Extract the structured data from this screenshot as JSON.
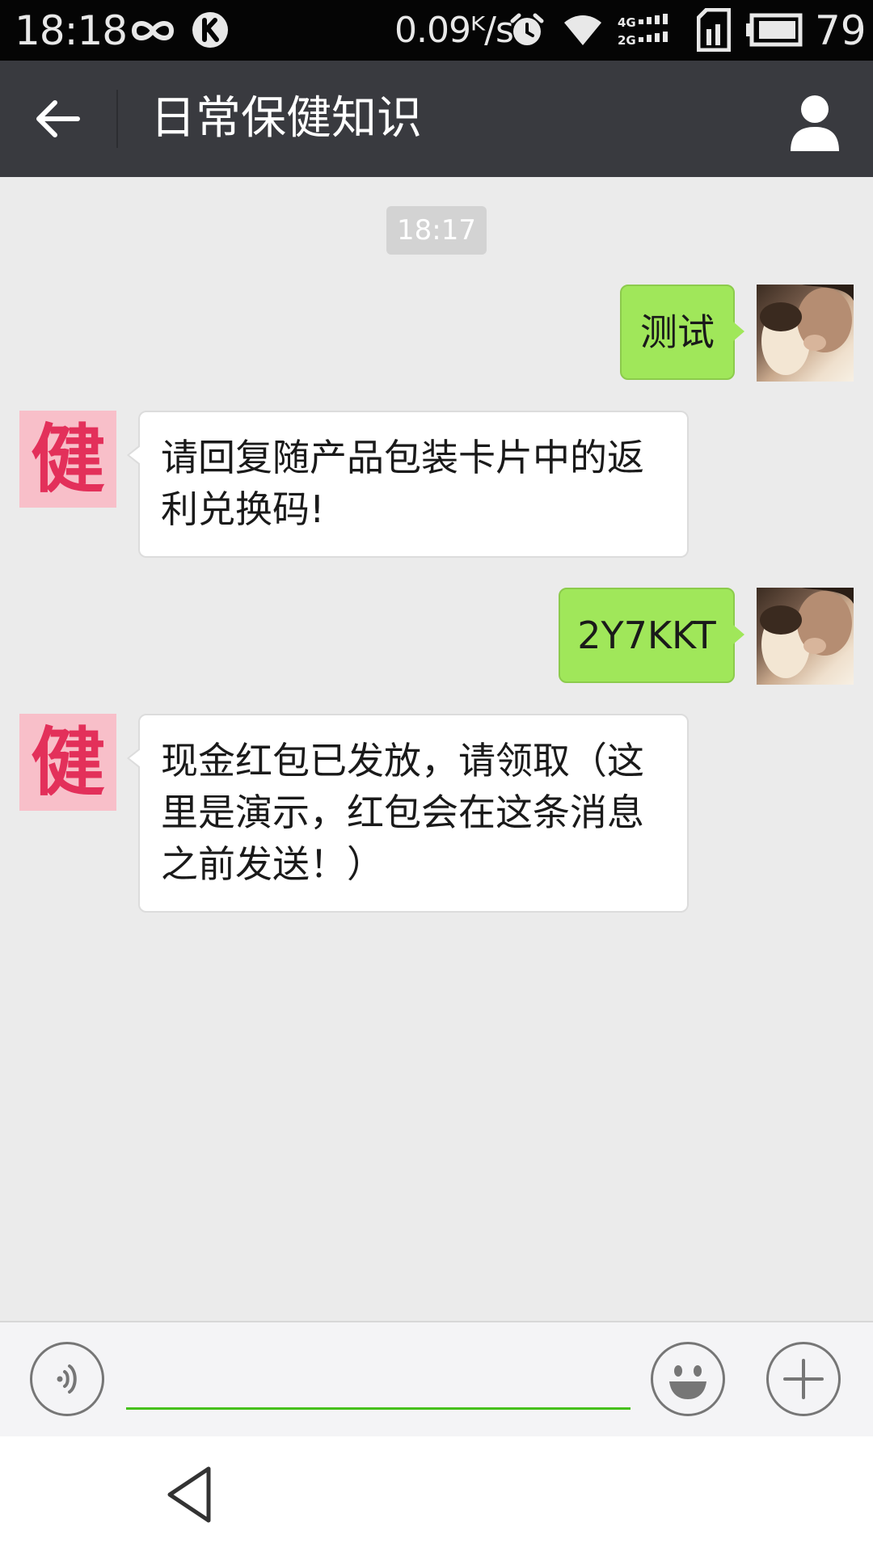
{
  "status_bar": {
    "time": "18:18",
    "net_speed": "0.09ᴷ/s",
    "battery_percent": "79",
    "icons": [
      "infinity-icon",
      "k-badge-icon",
      "alarm-clock-icon",
      "wifi-icon",
      "cellular-4g-2g-icon",
      "sim-card-icon",
      "battery-icon"
    ]
  },
  "header": {
    "title": "日常保健知识",
    "back_icon": "back-arrow-icon",
    "profile_icon": "person-icon"
  },
  "chat": {
    "timestamp": "18:17",
    "messages": [
      {
        "direction": "outgoing",
        "text": "测试",
        "avatar": "user-photo"
      },
      {
        "direction": "incoming",
        "text": "请回复随产品包装卡片中的返利兑换码!",
        "avatar_glyph": "健"
      },
      {
        "direction": "outgoing",
        "text": "2Y7KKT",
        "avatar": "user-photo"
      },
      {
        "direction": "incoming",
        "text": "现金红包已发放，请领取（这里是演示，红包会在这条消息之前发送！）",
        "avatar_glyph": "健"
      }
    ]
  },
  "composer": {
    "value": "",
    "placeholder": "",
    "voice_icon": "voice-icon",
    "emoji_icon": "emoji-icon",
    "plus_icon": "plus-icon"
  },
  "navigation": {
    "back_icon": "nav-back-triangle-icon"
  },
  "colors": {
    "status_bar": "#050505",
    "title_bar": "#393a3f",
    "chat_background": "#ebebeb",
    "outgoing_bubble": "#a0e75a",
    "incoming_bubble": "#ffffff",
    "bot_avatar": "#f8bfc9",
    "bot_avatar_glyph": "#e3305a",
    "input_underline": "#45c01a"
  }
}
